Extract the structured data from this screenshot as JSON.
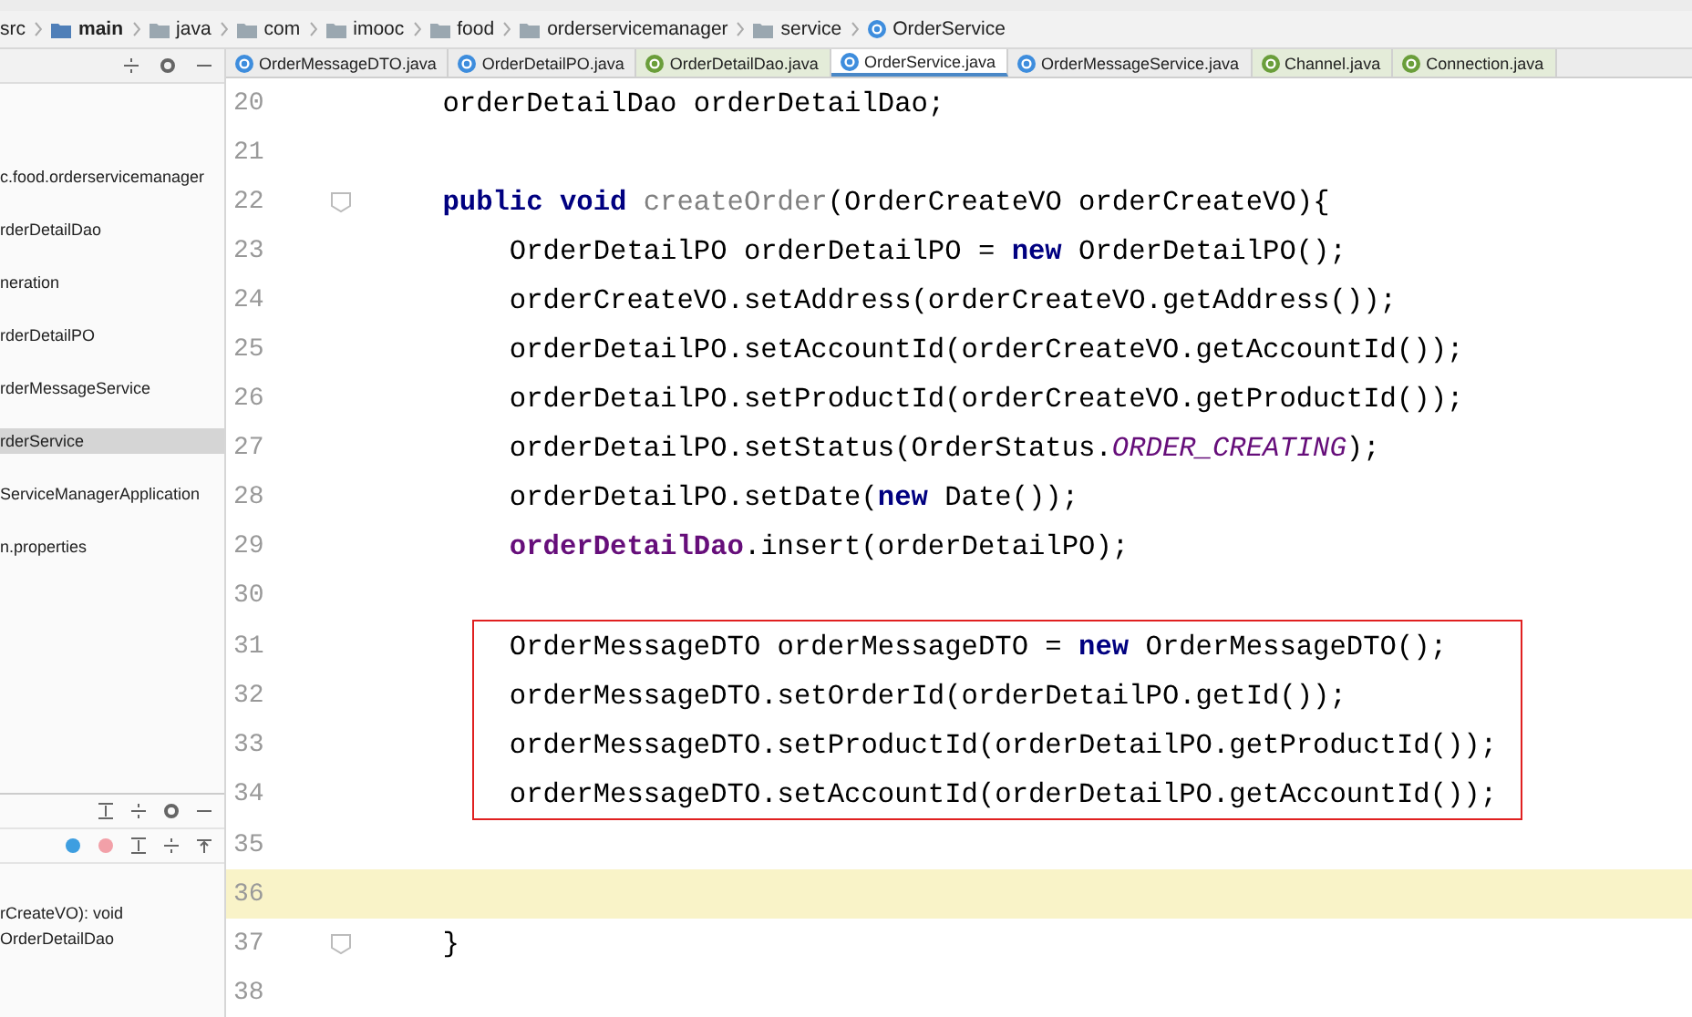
{
  "breadcrumbs": [
    {
      "label": "src",
      "kind": "folder"
    },
    {
      "label": "main",
      "kind": "source"
    },
    {
      "label": "java",
      "kind": "folder"
    },
    {
      "label": "com",
      "kind": "folder"
    },
    {
      "label": "imooc",
      "kind": "folder"
    },
    {
      "label": "food",
      "kind": "folder"
    },
    {
      "label": "orderservicemanager",
      "kind": "folder"
    },
    {
      "label": "service",
      "kind": "folder"
    },
    {
      "label": "OrderService",
      "kind": "class"
    }
  ],
  "tabs": [
    {
      "label": "OrderMessageDTO.java",
      "kind": "class",
      "selected": false
    },
    {
      "label": "OrderDetailPO.java",
      "kind": "class",
      "selected": false
    },
    {
      "label": "OrderDetailDao.java",
      "kind": "interface",
      "selected": false
    },
    {
      "label": "OrderService.java",
      "kind": "class",
      "selected": true
    },
    {
      "label": "OrderMessageService.java",
      "kind": "class",
      "selected": false
    },
    {
      "label": "Channel.java",
      "kind": "interface",
      "selected": false
    },
    {
      "label": "Connection.java",
      "kind": "interface",
      "selected": false
    }
  ],
  "project_tree": [
    {
      "label": "c.food.orderservicemanager",
      "selected": false
    },
    {
      "label": "rderDetailDao",
      "selected": false
    },
    {
      "label": "neration",
      "selected": false
    },
    {
      "label": "rderDetailPO",
      "selected": false
    },
    {
      "label": "rderMessageService",
      "selected": false
    },
    {
      "label": "rderService",
      "selected": true
    },
    {
      "label": "ServiceManagerApplication",
      "selected": false
    },
    {
      "label": "n.properties",
      "selected": false
    }
  ],
  "structure": [
    {
      "label": "rCreateVO): void"
    },
    {
      "label": "OrderDetailDao"
    }
  ],
  "code_lines": [
    {
      "number": "20",
      "current": false,
      "boxed": false,
      "fold": false,
      "tokens": [
        {
          "text": "    orderDetailDao orderDetailDao;",
          "kind": "plain"
        }
      ]
    },
    {
      "number": "21",
      "current": false,
      "boxed": false,
      "fold": false
    },
    {
      "number": "22",
      "current": false,
      "boxed": false,
      "fold": true,
      "tokens": [
        {
          "text": "    public void ",
          "kind": "keyword"
        },
        {
          "text": "createOrder",
          "kind": "unused"
        },
        {
          "text": "(OrderCreateVO orderCreateVO){",
          "kind": "plain"
        }
      ]
    },
    {
      "number": "23",
      "current": false,
      "boxed": false,
      "fold": false,
      "tokens": [
        {
          "text": "        OrderDetailPO orderDetailPO = ",
          "kind": "plain"
        },
        {
          "text": "new ",
          "kind": "keyword"
        },
        {
          "text": "OrderDetailPO();",
          "kind": "plain"
        }
      ]
    },
    {
      "number": "24",
      "current": false,
      "boxed": false,
      "fold": false,
      "tokens": [
        {
          "text": "        orderCreateVO.setAddress(orderCreateVO.getAddress());",
          "kind": "plain"
        }
      ]
    },
    {
      "number": "25",
      "current": false,
      "boxed": false,
      "fold": false,
      "tokens": [
        {
          "text": "        orderDetailPO.setAccountId(orderCreateVO.getAccountId());",
          "kind": "plain"
        }
      ]
    },
    {
      "number": "26",
      "current": false,
      "boxed": false,
      "fold": false,
      "tokens": [
        {
          "text": "        orderDetailPO.setProductId(orderCreateVO.getProductId());",
          "kind": "plain"
        }
      ]
    },
    {
      "number": "27",
      "current": false,
      "boxed": false,
      "fold": false,
      "tokens": [
        {
          "text": "        orderDetailPO.setStatus(OrderStatus.",
          "kind": "plain"
        },
        {
          "text": "ORDER_CREATING",
          "kind": "constant"
        },
        {
          "text": ");",
          "kind": "plain"
        }
      ]
    },
    {
      "number": "28",
      "current": false,
      "boxed": false,
      "fold": false,
      "tokens": [
        {
          "text": "        orderDetailPO.setDate(",
          "kind": "plain"
        },
        {
          "text": "new ",
          "kind": "keyword"
        },
        {
          "text": "Date());",
          "kind": "plain"
        }
      ]
    },
    {
      "number": "29",
      "current": false,
      "boxed": false,
      "fold": false,
      "tokens": [
        {
          "text": "        orderDetailDao",
          "kind": "field"
        },
        {
          "text": ".insert(orderDetailPO);",
          "kind": "plain"
        }
      ]
    },
    {
      "number": "30",
      "current": false,
      "boxed": false,
      "fold": false
    },
    {
      "number": "31",
      "current": false,
      "boxed": true,
      "fold": false,
      "tokens": [
        {
          "text": "        OrderMessageDTO orderMessageDTO = ",
          "kind": "plain"
        },
        {
          "text": "new ",
          "kind": "keyword"
        },
        {
          "text": "OrderMessageDTO();",
          "kind": "plain"
        }
      ]
    },
    {
      "number": "32",
      "current": false,
      "boxed": true,
      "fold": false,
      "tokens": [
        {
          "text": "        orderMessageDTO.setOrderId(orderDetailPO.getId());",
          "kind": "plain"
        }
      ]
    },
    {
      "number": "33",
      "current": false,
      "boxed": true,
      "fold": false,
      "tokens": [
        {
          "text": "        orderMessageDTO.setProductId(orderDetailPO.getProductId());",
          "kind": "plain"
        }
      ]
    },
    {
      "number": "34",
      "current": false,
      "boxed": true,
      "fold": false,
      "tokens": [
        {
          "text": "        orderMessageDTO.setAccountId(orderDetailPO.getAccountId());",
          "kind": "plain"
        }
      ]
    },
    {
      "number": "35",
      "current": false,
      "boxed": false,
      "fold": false
    },
    {
      "number": "36",
      "current": true,
      "boxed": false,
      "fold": false
    },
    {
      "number": "37",
      "current": false,
      "boxed": false,
      "fold": true,
      "tokens": [
        {
          "text": "    }",
          "kind": "plain"
        }
      ]
    },
    {
      "number": "38",
      "current": false,
      "boxed": false,
      "fold": false
    }
  ]
}
